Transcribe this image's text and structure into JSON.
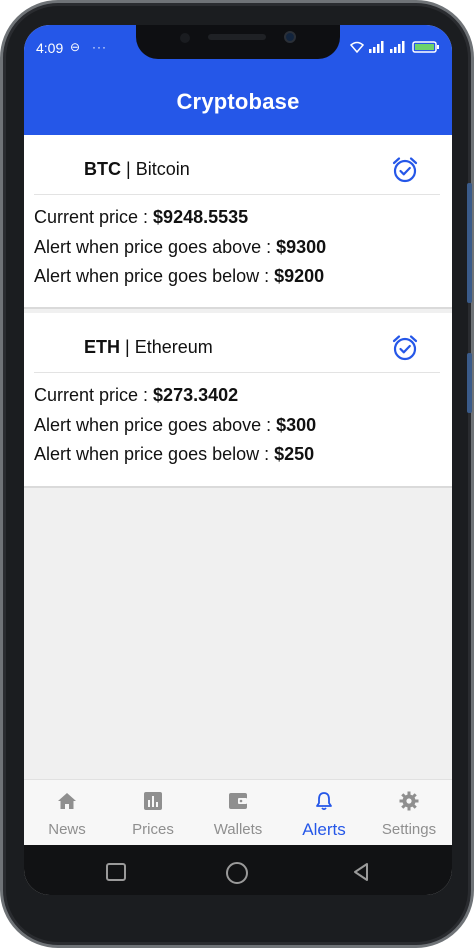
{
  "status": {
    "time": "4:09",
    "icons": [
      "notification-icon",
      "more-dots-icon",
      "wifi-icon",
      "signal-icon",
      "signal-icon",
      "battery-icon"
    ]
  },
  "app": {
    "title": "Cryptobase"
  },
  "alerts": [
    {
      "symbol": "BTC",
      "separator": " | ",
      "name": "Bitcoin",
      "current_label": "Current price : ",
      "current_value": "$9248.5535",
      "above_label": "Alert when price goes above : ",
      "above_value": "$9300",
      "below_label": "Alert when price goes below : ",
      "below_value": "$9200"
    },
    {
      "symbol": "ETH",
      "separator": " | ",
      "name": "Ethereum",
      "current_label": "Current price : ",
      "current_value": "$273.3402",
      "above_label": "Alert when price goes above : ",
      "above_value": "$300",
      "below_label": "Alert when price goes below : ",
      "below_value": "$250"
    }
  ],
  "tabs": [
    {
      "label": "News",
      "icon": "home-icon"
    },
    {
      "label": "Prices",
      "icon": "chart-icon"
    },
    {
      "label": "Wallets",
      "icon": "wallet-icon"
    },
    {
      "label": "Alerts",
      "icon": "bell-icon",
      "active": true
    },
    {
      "label": "Settings",
      "icon": "gear-icon"
    }
  ],
  "colors": {
    "primary": "#2557e8",
    "inactive": "#8f8f8f",
    "background": "#f0f0f0"
  }
}
